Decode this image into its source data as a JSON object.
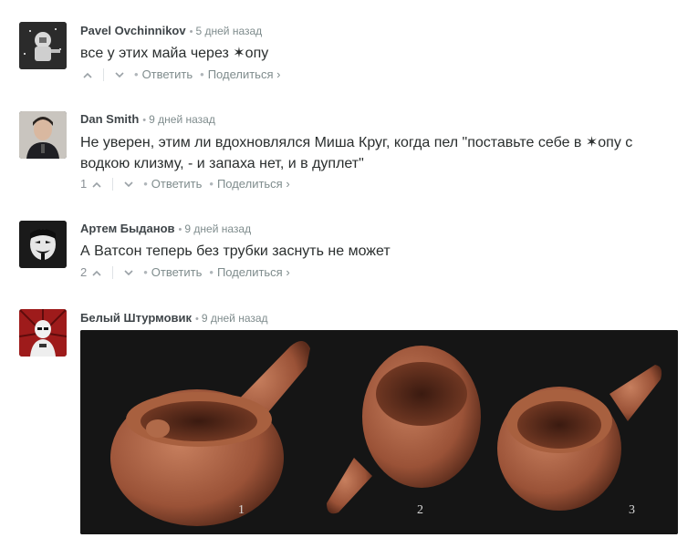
{
  "comments": [
    {
      "author": "Pavel Ovchinnikov",
      "time": "5 дней назад",
      "text": "все у этих майа через ✶опу",
      "votes": "",
      "reply": "Ответить",
      "share": "Поделиться ›"
    },
    {
      "author": "Dan Smith",
      "time": "9 дней назад",
      "text": "Не уверен, этим ли вдохновлялся Миша Круг, когда пел \"поставьте себе в ✶опу с водкою клизму, - и запаха нет, и в дуплет\"",
      "votes": "1",
      "reply": "Ответить",
      "share": "Поделиться ›"
    },
    {
      "author": "Артем Быданов",
      "time": "9 дней назад",
      "text": "А Ватсон теперь без трубки заснуть не может",
      "votes": "2",
      "reply": "Ответить",
      "share": "Поделиться ›"
    },
    {
      "author": "Белый Штурмовик",
      "time": "9 дней назад",
      "image_labels": [
        "1",
        "2",
        "3"
      ]
    }
  ],
  "icons": {
    "upvote": "chevron-up-icon",
    "downvote": "chevron-down-icon"
  }
}
